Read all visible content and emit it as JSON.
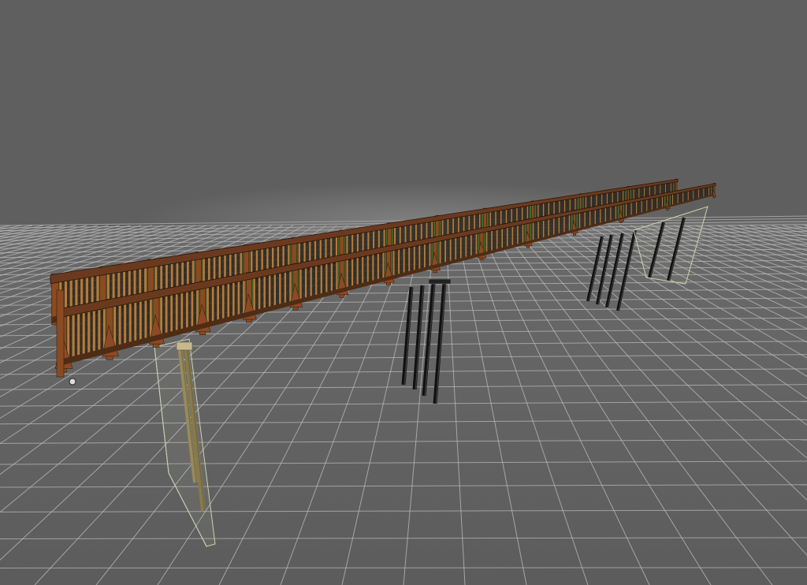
{
  "viewport": {
    "background_color": "#5f5f5f",
    "floor_color": "#646464",
    "grid_color": "#bdbdbd"
  },
  "model": {
    "rail_color": "#6b3a1e",
    "panel_color": "#3f6e2e",
    "post_color": "#8a4a22",
    "pile_color": "#111111",
    "selection_color": "#c8d3b0"
  }
}
